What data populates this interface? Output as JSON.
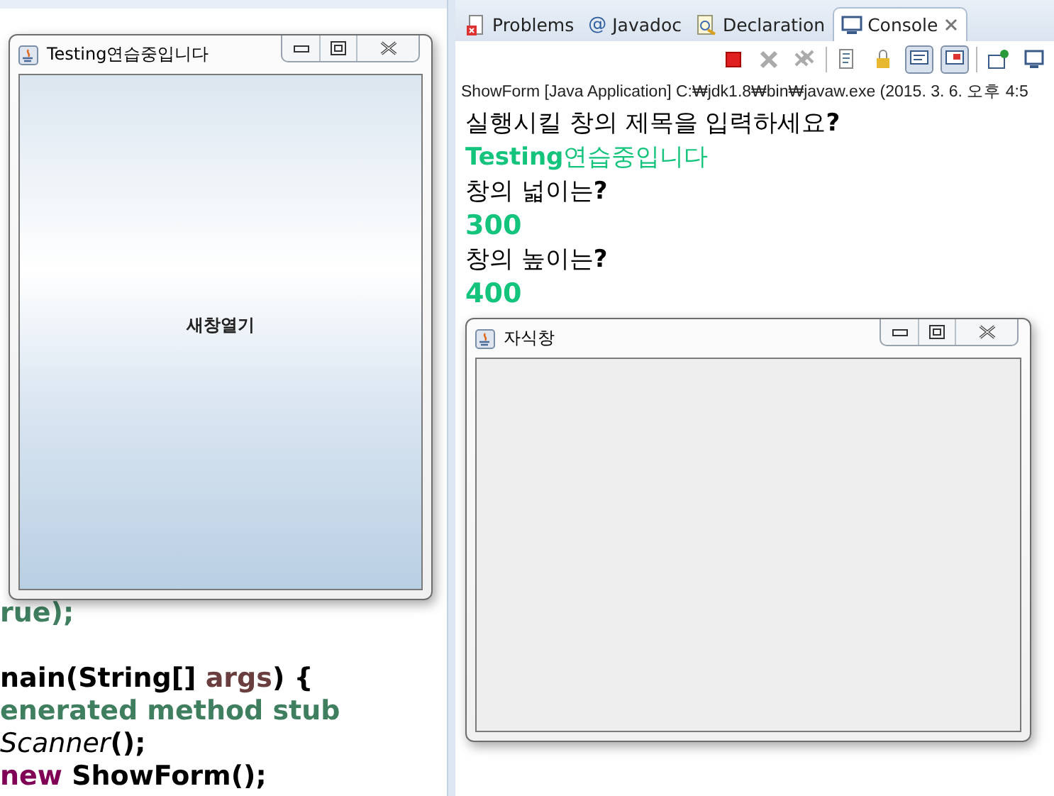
{
  "editor": {
    "lines": [
      {
        "left": [
          {
            "text": "rue);",
            "kind": "comment"
          }
        ]
      },
      {
        "left": [
          {
            "text": "nain(String[] ",
            "kind": "plain"
          },
          {
            "text": "args",
            "kind": "param"
          },
          {
            "text": ") {",
            "kind": "plain"
          }
        ]
      },
      {
        "left": [
          {
            "text": "enerated method stub",
            "kind": "comment"
          }
        ]
      },
      {
        "left": [
          {
            "text": "Scanner",
            "kind": "italic"
          },
          {
            "text": "();",
            "kind": "plain"
          }
        ]
      },
      {
        "left": [
          {
            "text": "new",
            "kind": "keyword"
          },
          {
            "text": " ShowForm();",
            "kind": "plain"
          }
        ]
      }
    ]
  },
  "console": {
    "tabs": [
      {
        "label": "Problems",
        "selected": false
      },
      {
        "icon_char": "@",
        "label": "Javadoc",
        "selected": false
      },
      {
        "label": "Declaration",
        "selected": false
      },
      {
        "label": "Console",
        "selected": true
      }
    ],
    "launch_info": "ShowForm [Java Application] C:₩jdk1.8₩bin₩javaw.exe (2015. 3. 6. 오후 4:5",
    "output": [
      {
        "text": "실행시킬 창의 제목을 입력하세요**?**",
        "kind": "prompt"
      },
      {
        "text": "**Testing**연습중입니다",
        "kind": "input"
      },
      {
        "text": "창의 넓이는**?**",
        "kind": "prompt"
      },
      {
        "text": "300",
        "kind": "input"
      },
      {
        "text": "창의 높이는**?**",
        "kind": "prompt"
      },
      {
        "text": "400",
        "kind": "input"
      }
    ]
  },
  "main_window": {
    "title": "Testing연습중입니다",
    "button": "새창열기"
  },
  "child_window": {
    "title": "자식창"
  }
}
